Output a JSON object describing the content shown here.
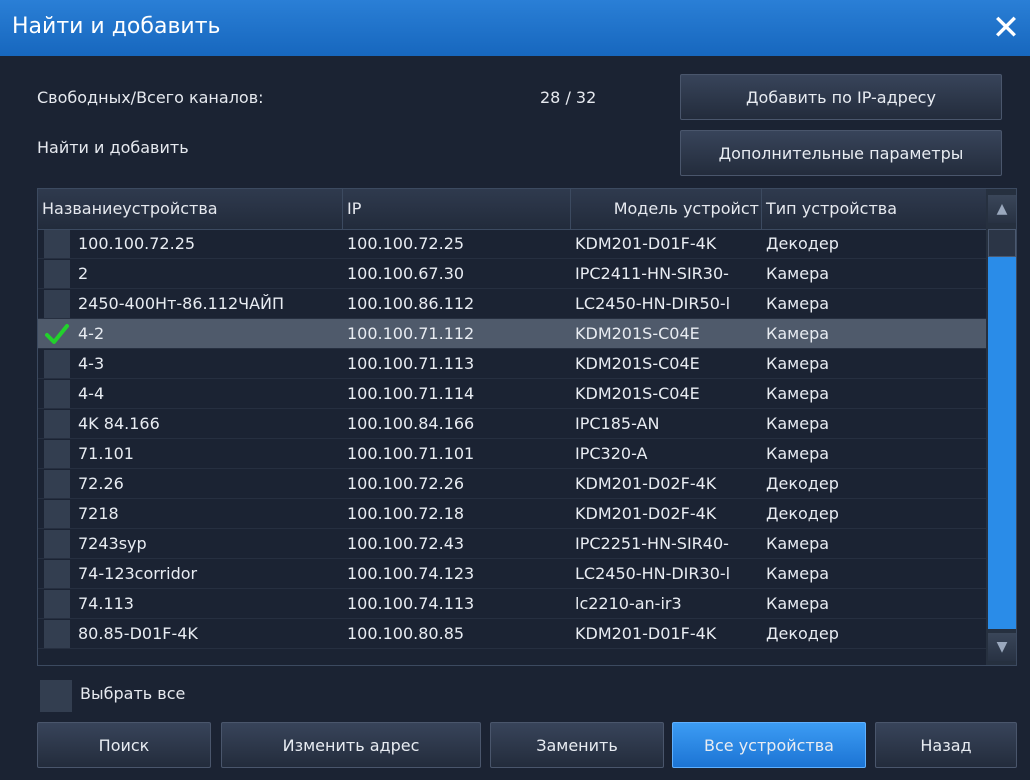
{
  "window": {
    "title": "Найти и добавить",
    "close_symbol": "✕"
  },
  "info": {
    "channels_label": "Свободных/Всего каналов:",
    "channels_value": "28 / 32",
    "search_label": "Найти и добавить"
  },
  "buttons": {
    "add_by_ip": "Добавить по IP-адресу",
    "advanced": "Дополнительные параметры",
    "search": "Поиск",
    "change_address": "Изменить адрес",
    "replace": "Заменить",
    "all_devices": "Все устройства",
    "back": "Назад"
  },
  "table": {
    "headers": [
      "Названиеустройства",
      "IP",
      "Модель устройст",
      "Тип устройства"
    ],
    "rows": [
      {
        "checked": false,
        "name": "100.100.72.25",
        "ip": "100.100.72.25",
        "model": "KDM201-D01F-4K",
        "type": "Декодер"
      },
      {
        "checked": false,
        "name": "2",
        "ip": "100.100.67.30",
        "model": "IPC2411-HN-SIR30-",
        "type": "Камера"
      },
      {
        "checked": false,
        "name": "2450-400Нт-86.112ЧАЙП",
        "ip": "100.100.86.112",
        "model": "LC2450-HN-DIR50-l",
        "type": "Камера"
      },
      {
        "checked": true,
        "name": "4-2",
        "ip": "100.100.71.112",
        "model": "KDM201S-C04E",
        "type": "Камера"
      },
      {
        "checked": false,
        "name": "4-3",
        "ip": "100.100.71.113",
        "model": "KDM201S-C04E",
        "type": "Камера"
      },
      {
        "checked": false,
        "name": "4-4",
        "ip": "100.100.71.114",
        "model": "KDM201S-C04E",
        "type": "Камера"
      },
      {
        "checked": false,
        "name": "4K 84.166",
        "ip": "100.100.84.166",
        "model": "IPC185-AN",
        "type": "Камера"
      },
      {
        "checked": false,
        "name": "71.101",
        "ip": "100.100.71.101",
        "model": "IPC320-A",
        "type": "Камера"
      },
      {
        "checked": false,
        "name": "72.26",
        "ip": "100.100.72.26",
        "model": "KDM201-D02F-4K",
        "type": "Декодер"
      },
      {
        "checked": false,
        "name": "7218",
        "ip": "100.100.72.18",
        "model": "KDM201-D02F-4K",
        "type": "Декодер"
      },
      {
        "checked": false,
        "name": "7243syp",
        "ip": "100.100.72.43",
        "model": "IPC2251-HN-SIR40-",
        "type": "Камера"
      },
      {
        "checked": false,
        "name": "74-123corridor",
        "ip": "100.100.74.123",
        "model": "LC2450-HN-DIR30-l",
        "type": "Камера"
      },
      {
        "checked": false,
        "name": "74.113",
        "ip": "100.100.74.113",
        "model": "lc2210-an-ir3",
        "type": "Камера"
      },
      {
        "checked": false,
        "name": "80.85-D01F-4K",
        "ip": "100.100.80.85",
        "model": "KDM201-D01F-4K",
        "type": "Декодер"
      }
    ]
  },
  "select_all": {
    "label": "Выбрать все",
    "checked": false
  },
  "scrollbar": {
    "up_symbol": "▲",
    "down_symbol": "▼"
  },
  "colors": {
    "titlebar": "#1f73cc",
    "accent": "#2a8ce8",
    "check": "#22d12c",
    "selected_row": "#4f5a6b"
  }
}
